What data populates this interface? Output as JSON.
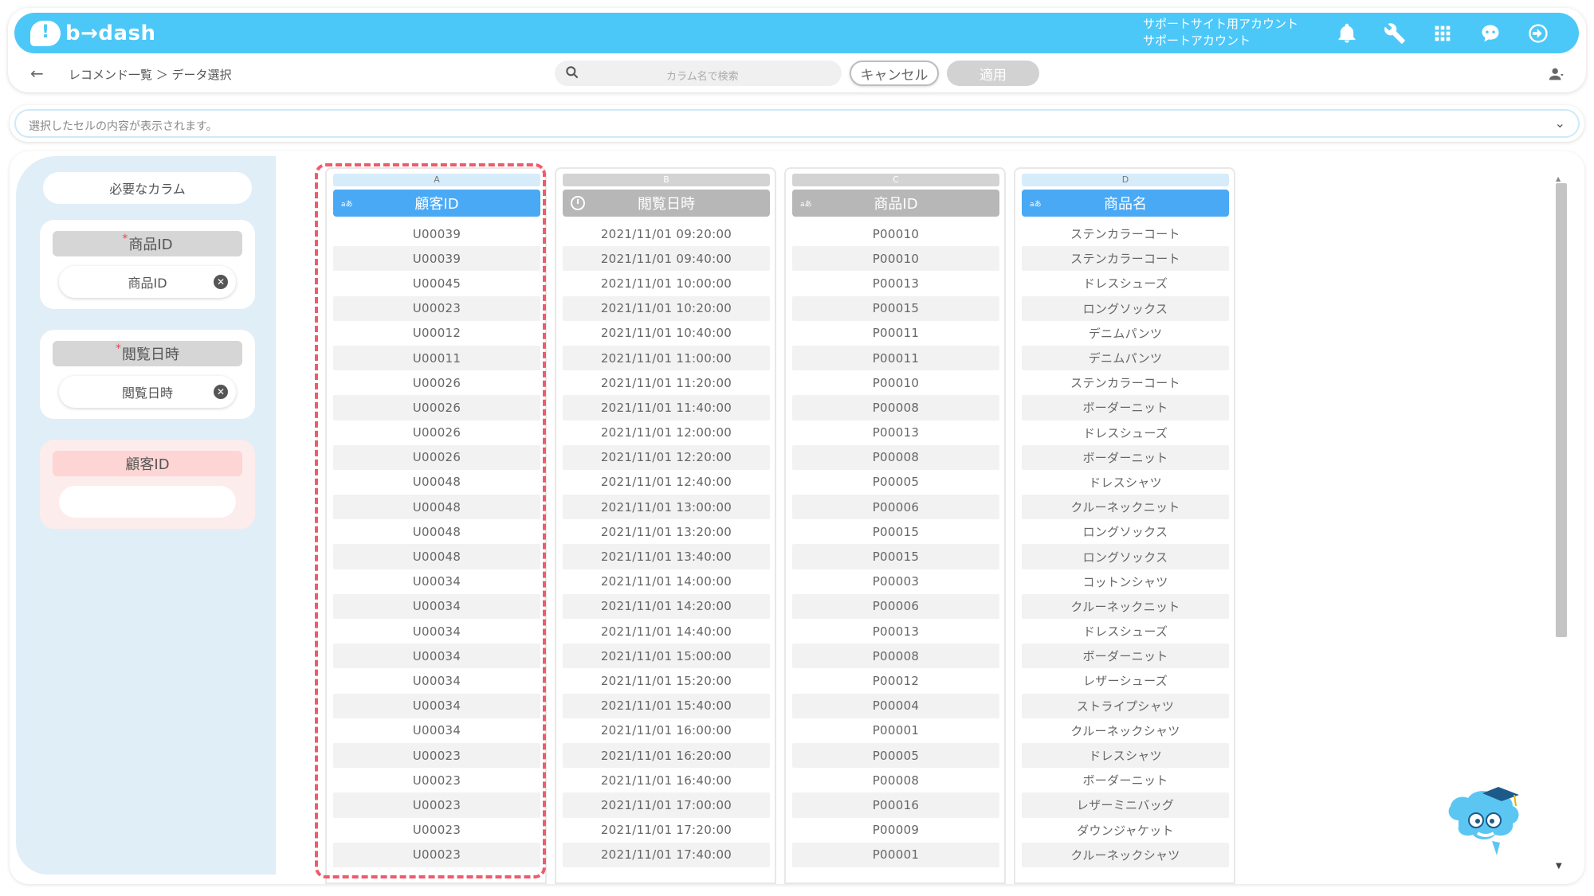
{
  "header": {
    "logo_text": "b→dash",
    "account_line1": "サポートサイト用アカウント",
    "account_line2": "サポートアカウント",
    "icons": [
      "bell-icon",
      "wrench-icon",
      "apps-grid-icon",
      "mascot-chat-icon",
      "logout-icon"
    ]
  },
  "toolbar": {
    "breadcrumb": "レコメンド一覧 ＞ データ選択",
    "search_placeholder": "カラム名で検索",
    "cancel_label": "キャンセル",
    "apply_label": "適用"
  },
  "cellbar": {
    "text": "選択したセルの内容が表示されます。"
  },
  "left_panel": {
    "title": "必要なカラム",
    "slots": [
      {
        "required": true,
        "label": "商品ID",
        "value": "商品ID"
      },
      {
        "required": true,
        "label": "閲覧日時",
        "value": "閲覧日時"
      },
      {
        "required": false,
        "label": "顧客ID",
        "value": ""
      }
    ]
  },
  "columns": [
    {
      "letter": "A",
      "name": "顧客ID",
      "type_tag": "aあ",
      "selected": true,
      "values": [
        "U00039",
        "U00039",
        "U00045",
        "U00023",
        "U00012",
        "U00011",
        "U00026",
        "U00026",
        "U00026",
        "U00026",
        "U00048",
        "U00048",
        "U00048",
        "U00048",
        "U00034",
        "U00034",
        "U00034",
        "U00034",
        "U00034",
        "U00034",
        "U00034",
        "U00023",
        "U00023",
        "U00023",
        "U00023",
        "U00023"
      ]
    },
    {
      "letter": "B",
      "name": "閲覧日時",
      "type_tag": "",
      "selected": false,
      "values": [
        "2021/11/01 09:20:00",
        "2021/11/01 09:40:00",
        "2021/11/01 10:00:00",
        "2021/11/01 10:20:00",
        "2021/11/01 10:40:00",
        "2021/11/01 11:00:00",
        "2021/11/01 11:20:00",
        "2021/11/01 11:40:00",
        "2021/11/01 12:00:00",
        "2021/11/01 12:20:00",
        "2021/11/01 12:40:00",
        "2021/11/01 13:00:00",
        "2021/11/01 13:20:00",
        "2021/11/01 13:40:00",
        "2021/11/01 14:00:00",
        "2021/11/01 14:20:00",
        "2021/11/01 14:40:00",
        "2021/11/01 15:00:00",
        "2021/11/01 15:20:00",
        "2021/11/01 15:40:00",
        "2021/11/01 16:00:00",
        "2021/11/01 16:20:00",
        "2021/11/01 16:40:00",
        "2021/11/01 17:00:00",
        "2021/11/01 17:20:00",
        "2021/11/01 17:40:00"
      ]
    },
    {
      "letter": "C",
      "name": "商品ID",
      "type_tag": "aあ",
      "selected": false,
      "values": [
        "P00010",
        "P00010",
        "P00013",
        "P00015",
        "P00011",
        "P00011",
        "P00010",
        "P00008",
        "P00013",
        "P00008",
        "P00005",
        "P00006",
        "P00015",
        "P00015",
        "P00003",
        "P00006",
        "P00013",
        "P00008",
        "P00012",
        "P00004",
        "P00001",
        "P00005",
        "P00008",
        "P00016",
        "P00009",
        "P00001"
      ]
    },
    {
      "letter": "D",
      "name": "商品名",
      "type_tag": "aあ",
      "selected": true,
      "values": [
        "ステンカラーコート",
        "ステンカラーコート",
        "ドレスシューズ",
        "ロングソックス",
        "デニムパンツ",
        "デニムパンツ",
        "ステンカラーコート",
        "ボーダーニット",
        "ドレスシューズ",
        "ボーダーニット",
        "ドレスシャツ",
        "クルーネックニット",
        "ロングソックス",
        "ロングソックス",
        "コットンシャツ",
        "クルーネックニット",
        "ドレスシューズ",
        "ボーダーニット",
        "レザーシューズ",
        "ストライプシャツ",
        "クルーネックシャツ",
        "ドレスシャツ",
        "ボーダーニット",
        "レザーミニバッグ",
        "ダウンジャケット",
        "クルーネックシャツ"
      ]
    }
  ],
  "colors": {
    "brand_blue": "#4cc8f8",
    "selected_header": "#4aa9f5",
    "unselected_header": "#b7b7b7",
    "selection_dash": "#ef5b6a"
  }
}
